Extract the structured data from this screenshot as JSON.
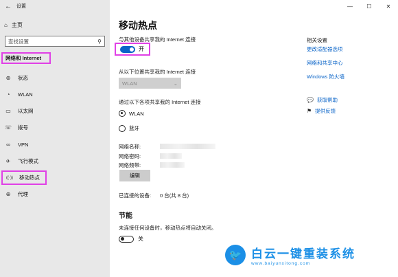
{
  "window": {
    "title": "设置",
    "back": "←",
    "minimize": "—",
    "maximize": "☐",
    "close": "✕"
  },
  "sidebar": {
    "home": "主页",
    "search_placeholder": "查找设置",
    "section": "网络和 Internet",
    "items": [
      {
        "label": "状态",
        "icon": "globe-icon",
        "glyph": "⊕"
      },
      {
        "label": "WLAN",
        "icon": "wifi-icon",
        "glyph": "◔"
      },
      {
        "label": "以太网",
        "icon": "ethernet-icon",
        "glyph": "▭"
      },
      {
        "label": "拨号",
        "icon": "dialup-icon",
        "glyph": "☏"
      },
      {
        "label": "VPN",
        "icon": "vpn-icon",
        "glyph": "∞"
      },
      {
        "label": "飞行模式",
        "icon": "airplane-icon",
        "glyph": "✈"
      },
      {
        "label": "移动热点",
        "icon": "hotspot-icon",
        "glyph": "((·))"
      },
      {
        "label": "代理",
        "icon": "proxy-icon",
        "glyph": "⊕"
      }
    ]
  },
  "main": {
    "title": "移动热点",
    "share_label": "与其他设备共享我的 Internet 连接",
    "share_toggle_text": "开",
    "share_from_label": "从以下位置共享我的 Internet 连接",
    "share_from_value": "WLAN",
    "share_over_label": "通过以下各项共享我的 Internet 连接",
    "radio_wlan": "WLAN",
    "radio_bt": "蓝牙",
    "network_name_label": "网络名称:",
    "network_password_label": "网络密码:",
    "network_band_label": "网络频带:",
    "edit_button": "编辑",
    "connected_label": "已连接的设备:",
    "connected_value": "0 台(共 8 台)",
    "power_title": "节能",
    "power_desc": "未连接任何设备时，移动热点将自动关闭。",
    "power_toggle_text": "关"
  },
  "related": {
    "title": "相关设置",
    "links": [
      "更改适配器选项",
      "网络和共享中心",
      "Windows 防火墙"
    ],
    "help": "获取帮助",
    "feedback": "提供反馈"
  },
  "watermark": {
    "main": "白云一键重装系统",
    "url": "www.baiyunxitong.com"
  },
  "colors": {
    "accent": "#0a64c8",
    "highlight": "#e040e6"
  }
}
